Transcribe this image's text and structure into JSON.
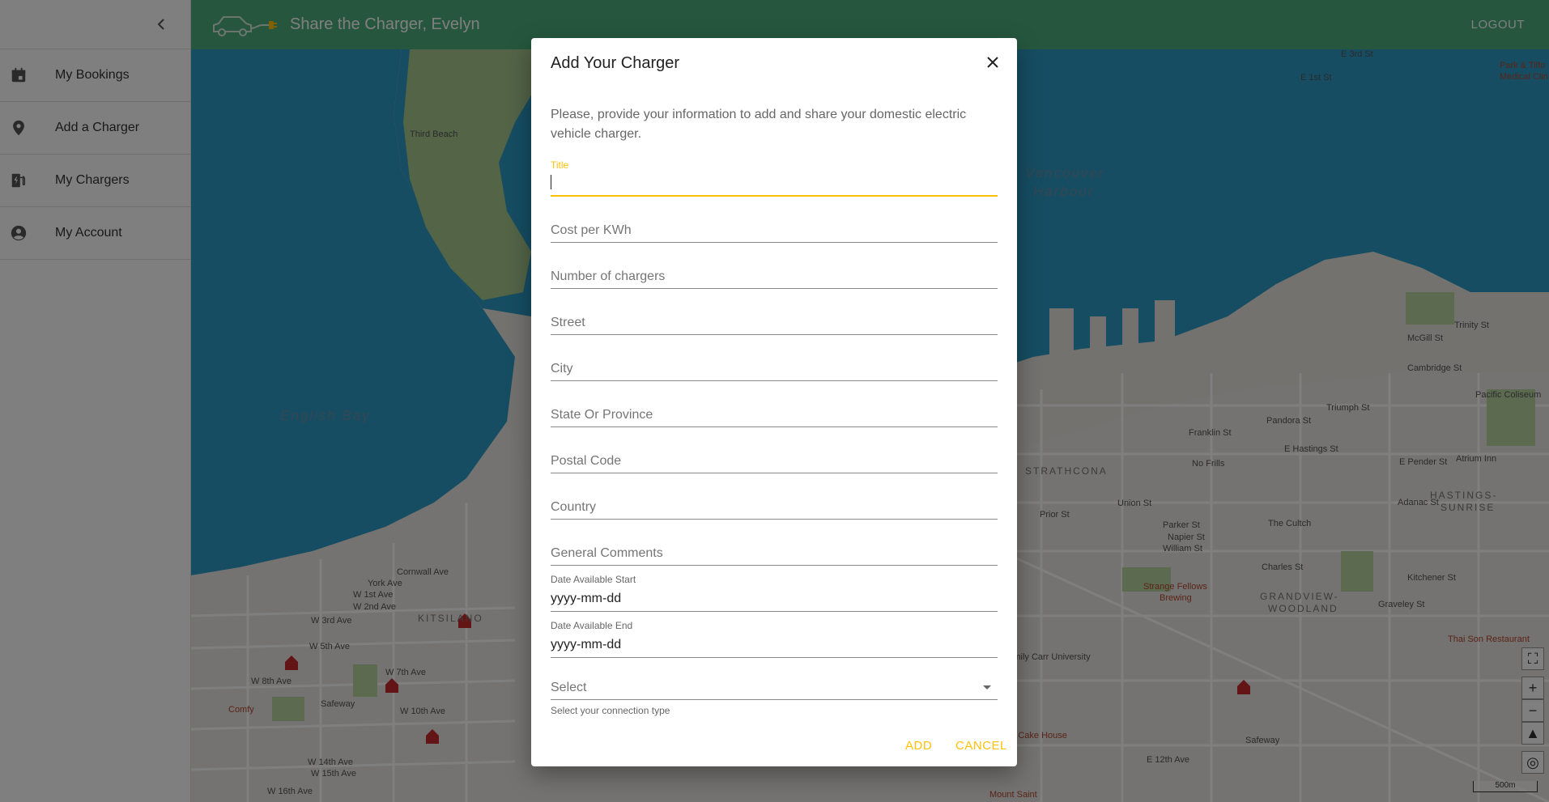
{
  "sidebar": {
    "collapse_icon": "chevron-left-icon",
    "items": [
      {
        "label": "My Bookings",
        "icon": "calendar-icon"
      },
      {
        "label": "Add a Charger",
        "icon": "map-pin-icon"
      },
      {
        "label": "My Chargers",
        "icon": "ev-station-icon"
      },
      {
        "label": "My Account",
        "icon": "account-circle-icon"
      }
    ]
  },
  "appbar": {
    "title": "Share the Charger, Evelyn",
    "logout": "LOGOUT",
    "logo_icon": "car-plug-icon",
    "color": "#4caf7d"
  },
  "map": {
    "labels": {
      "third_beach": "Third Beach",
      "english_bay": "English Bay",
      "vancouver_harbour_1": "Vancouver",
      "vancouver_harbour_2": "Harbour",
      "kitsilano": "KITSILANO",
      "strathcona": "STRATHCONA",
      "grandview": "GRANDVIEW-",
      "woodland": "WOODLAND",
      "hastings": "HASTINGS-",
      "sunrise": "SUNRISE",
      "cornwall": "Cornwall Ave",
      "york": "York Ave",
      "w1st": "W 1st Ave",
      "w2nd": "W 2nd Ave",
      "w3rd": "W 3rd Ave",
      "w5th": "W 5th Ave",
      "w7th": "W 7th Ave",
      "w8th": "W 8th Ave",
      "w10th": "W 10th Ave",
      "w14th": "W 14th Ave",
      "w15th": "W 15th Ave",
      "w16th": "W 16th Ave",
      "safeway_w": "Safeway",
      "comfy": "Comfy",
      "e_hastings": "E Hastings St",
      "pandora": "Pandora St",
      "franklin": "Franklin St",
      "no_frills": "No Frills",
      "prior": "Prior St",
      "union": "Union St",
      "parker": "Parker St",
      "napier": "Napier St",
      "william": "William St",
      "the_cultch": "The Cultch",
      "charles": "Charles St",
      "kitchener": "Kitchener St",
      "graveley": "Graveley St",
      "adanac": "Adanac St",
      "strange_fellows": "Strange Fellows",
      "brewing": "Brewing",
      "thai_son": "Thai Son Restaurant",
      "annas_cake": "Anna's Cake House",
      "safeway_e": "Safeway",
      "mount_saint": "Mount Saint",
      "emily_carr": "Emily Carr University",
      "e12th": "E 12th Ave",
      "e_1st": "E 1st St",
      "e_3rd": "E 3rd St",
      "trinity": "Trinity St",
      "mcgill": "McGill St",
      "cambridge": "Cambridge St",
      "triumph": "Triumph St",
      "pacific_coliseum": "Pacific Coliseum",
      "atrium_inn": "Atrium Inn",
      "e_pender": "E Pender St",
      "park_tilford": "Park & Tilfo",
      "medical": "Medical Clin",
      "scale": "500m"
    }
  },
  "dialog": {
    "title": "Add Your Charger",
    "description": "Please, provide your information to add and share your domestic electric vehicle charger.",
    "fields": {
      "title_label": "Title",
      "cost": "Cost per KWh",
      "num_chargers": "Number of chargers",
      "street": "Street",
      "city": "City",
      "state": "State Or Province",
      "postal": "Postal Code",
      "country": "Country",
      "comments": "General Comments",
      "date_start_label": "Date Available Start",
      "date_start_value": "yyyy-mm-dd",
      "date_end_label": "Date Available End",
      "date_end_value": "yyyy-mm-dd",
      "select_placeholder": "Select",
      "select_helper": "Select your connection type"
    },
    "add_label": "ADD",
    "cancel_label": "CANCEL",
    "accent_color": "#ffc107"
  }
}
